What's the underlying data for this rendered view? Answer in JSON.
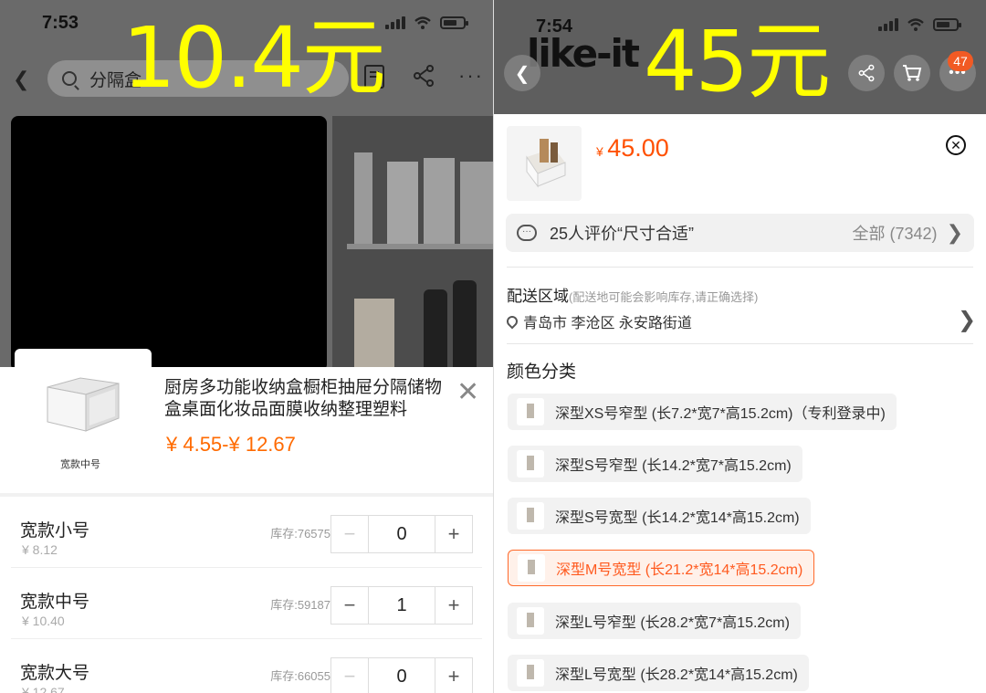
{
  "left": {
    "status_time": "7:53",
    "search_placeholder": "分隔盒",
    "overlay_price": "10.4元",
    "product_title": "厨房多功能收纳盒橱柜抽屉分隔储物盒桌面化妆品面膜收纳整理塑料",
    "price_range": "¥ 4.55-¥ 12.67",
    "thumb_caption": "宽款中号",
    "skus": [
      {
        "name": "宽款小号",
        "price": "¥ 8.12",
        "stock": "库存:76575",
        "qty": "0",
        "minus_disabled": true
      },
      {
        "name": "宽款中号",
        "price": "¥ 10.40",
        "stock": "库存:59187",
        "qty": "1",
        "minus_disabled": false
      },
      {
        "name": "宽款大号",
        "price": "¥ 12.67",
        "stock": "库存:66055",
        "qty": "0",
        "minus_disabled": true
      }
    ],
    "icons": [
      "back-icon",
      "search-icon",
      "edit-icon",
      "share-icon",
      "more-icon",
      "close-icon"
    ]
  },
  "right": {
    "status_time": "7:54",
    "logo": "like-it",
    "overlay_price": "45元",
    "badge_count": "47",
    "price_yen": "¥",
    "price_value": "45.00",
    "review_text": "25人评价“尺寸合适”",
    "review_all": "全部 (7342)",
    "delivery_label": "配送区域",
    "delivery_note": "(配送地可能会影响库存,请正确选择)",
    "address": "青岛市 李沧区 永安路街道",
    "color_heading": "颜色分类",
    "options": [
      {
        "label": "深型XS号窄型 (长7.2*宽7*高15.2cm)（专利登录中)",
        "selected": false
      },
      {
        "label": "深型S号窄型 (长14.2*宽7*高15.2cm)",
        "selected": false
      },
      {
        "label": "深型S号宽型 (长14.2*宽14*高15.2cm)",
        "selected": false
      },
      {
        "label": "深型M号宽型 (长21.2*宽14*高15.2cm)",
        "selected": true
      },
      {
        "label": "深型L号窄型 (长28.2*宽7*高15.2cm)",
        "selected": false
      },
      {
        "label": "深型L号宽型 (长28.2*宽14*高15.2cm)",
        "selected": false
      }
    ],
    "icons": [
      "back-icon",
      "share-icon",
      "cart-icon",
      "more-icon",
      "close-circle-icon",
      "chat-icon",
      "location-icon"
    ]
  },
  "colors": {
    "accent": "#ff5000",
    "overlay_text": "#ffff00"
  }
}
